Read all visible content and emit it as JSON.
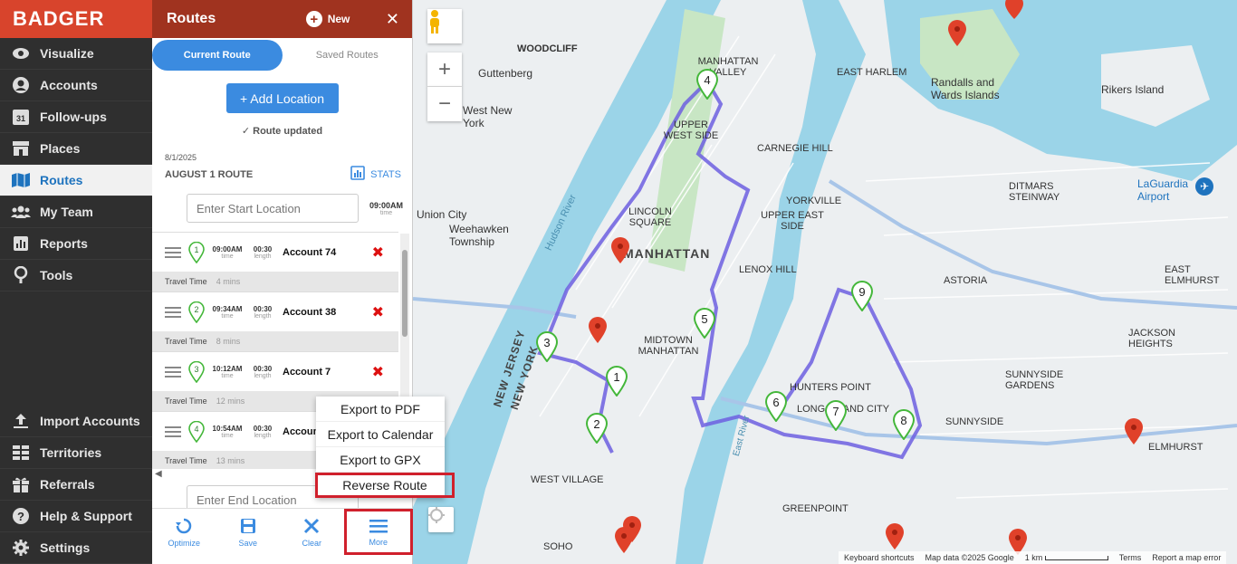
{
  "brand": "BADGER",
  "nav": {
    "top": [
      {
        "label": "Visualize",
        "icon": "eye-icon"
      },
      {
        "label": "Accounts",
        "icon": "person-icon"
      },
      {
        "label": "Follow-ups",
        "icon": "calendar-icon",
        "icon_text": "31"
      },
      {
        "label": "Places",
        "icon": "store-icon"
      },
      {
        "label": "Routes",
        "icon": "map-icon",
        "active": true
      },
      {
        "label": "My Team",
        "icon": "team-icon"
      },
      {
        "label": "Reports",
        "icon": "chart-icon"
      },
      {
        "label": "Tools",
        "icon": "wrench-icon"
      }
    ],
    "bottom": [
      {
        "label": "Import Accounts",
        "icon": "upload-icon"
      },
      {
        "label": "Territories",
        "icon": "grid-icon"
      },
      {
        "label": "Referrals",
        "icon": "gift-icon"
      },
      {
        "label": "Help & Support",
        "icon": "help-icon"
      },
      {
        "label": "Settings",
        "icon": "gear-icon"
      }
    ]
  },
  "panel": {
    "title": "Routes",
    "new_label": "New",
    "tabs": [
      {
        "label": "Current Route",
        "active": true
      },
      {
        "label": "Saved Routes",
        "active": false
      }
    ],
    "add_location_label": "+ Add Location",
    "route_updated": "Route updated",
    "route_date": "8/1/2025",
    "route_name": "AUGUST 1 ROUTE",
    "stats_label": "STATS",
    "start_placeholder": "Enter Start Location",
    "start_time": "09:00AM",
    "start_time_sub": "time",
    "end_placeholder": "Enter End Location",
    "stops": [
      {
        "num": "1",
        "time": "09:00AM",
        "time_sub": "time",
        "length": "00:30",
        "length_sub": "length",
        "account": "Account 74",
        "travel_label": "Travel Time",
        "travel_value": "4 mins"
      },
      {
        "num": "2",
        "time": "09:34AM",
        "time_sub": "time",
        "length": "00:30",
        "length_sub": "length",
        "account": "Account 38",
        "travel_label": "Travel Time",
        "travel_value": "8 mins"
      },
      {
        "num": "3",
        "time": "10:12AM",
        "time_sub": "time",
        "length": "00:30",
        "length_sub": "length",
        "account": "Account 7",
        "travel_label": "Travel Time",
        "travel_value": "12 mins"
      },
      {
        "num": "4",
        "time": "10:54AM",
        "time_sub": "time",
        "length": "00:30",
        "length_sub": "length",
        "account": "Account",
        "travel_label": "Travel Time",
        "travel_value": "13 mins"
      }
    ],
    "toolbar": [
      {
        "label": "Optimize",
        "icon": "optimize-icon"
      },
      {
        "label": "Save",
        "icon": "save-icon"
      },
      {
        "label": "Clear",
        "icon": "clear-icon"
      },
      {
        "label": "More",
        "icon": "menu-icon",
        "highlight": true
      }
    ]
  },
  "menu": {
    "items": [
      {
        "label": "Export to PDF"
      },
      {
        "label": "Export to Calendar"
      },
      {
        "label": "Export to GPX"
      },
      {
        "label": "Reverse Route",
        "highlight": true
      }
    ]
  },
  "map": {
    "labels": {
      "manhattan": "MANHATTAN",
      "upper_west_side": "UPPER WEST SIDE",
      "lincoln_square": "LINCOLN SQUARE",
      "midtown_manhattan": "MIDTOWN MANHATTAN",
      "west_village": "WEST VILLAGE",
      "soho": "SOHO",
      "east_harlem": "EAST HARLEM",
      "manhattan_valley": "MANHATTAN VALLEY",
      "carnegie_hill": "CARNEGIE HILL",
      "yorkville": "YORKVILLE",
      "upper_east_side": "UPPER EAST SIDE",
      "lenox_hill": "LENOX HILL",
      "astoria": "ASTORIA",
      "ditmars_steinway": "DITMARS STEINWAY",
      "hunters_point": "HUNTERS POINT",
      "long_island_city": "LONG ISLAND CITY",
      "sunnyside": "SUNNYSIDE",
      "sunnyside_gardens": "SUNNYSIDE GARDENS",
      "jackson_heights": "JACKSON HEIGHTS",
      "east_elmhurst": "EAST ELMHURST",
      "elmhurst": "ELMHURST",
      "greenpoint": "GREENPOINT",
      "woodcliff": "WOODCLIFF",
      "guttenberg": "Guttenberg",
      "west_new_york": "West New York",
      "union_city": "Union City",
      "weehawken": "Weehawken Township",
      "new_jersey": "NEW JERSEY",
      "new_york": "NEW YORK",
      "randalls": "Randalls and Wards Islands",
      "rikers": "Rikers Island",
      "laguardia": "LaGuardia Airport",
      "hudson_river": "Hudson River",
      "east_river": "East River"
    },
    "pins": [
      "1",
      "2",
      "3",
      "4",
      "5",
      "6",
      "7",
      "8",
      "9"
    ],
    "footer": {
      "shortcuts": "Keyboard shortcuts",
      "data": "Map data ©2025 Google",
      "scale": "1 km",
      "terms": "Terms",
      "report": "Report a map error"
    },
    "colors": {
      "water": "#9bd4e8",
      "park": "#c8e6c4",
      "route": "#6d5fe0",
      "pin_green": "#44b73a",
      "pin_red": "#e0412a"
    }
  }
}
